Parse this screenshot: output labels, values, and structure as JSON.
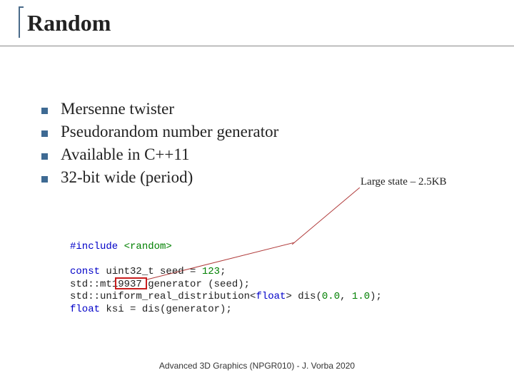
{
  "title": "Random",
  "bullets": [
    "Mersenne twister",
    "Pseudorandom number generator",
    "Available in C++11",
    "32-bit wide (period)"
  ],
  "annotation": "Large state – 2.5KB",
  "code": {
    "include_kw": "#include",
    "include_hdr": "<random>",
    "l1_a": "const",
    "l1_b": " uint32_t seed = ",
    "l1_c": "123",
    "l1_d": ";",
    "l2_a": "std::mt",
    "l2_hl": "19937",
    "l2_b": " generator (seed);",
    "l3_a": "std::uniform_real_distribution<",
    "l3_b": "float",
    "l3_c": "> dis(",
    "l3_d": "0.0",
    "l3_e": ", ",
    "l3_f": "1.0",
    "l3_g": ");",
    "l4_a": "float",
    "l4_b": " ksi = dis(generator);"
  },
  "footer": "Advanced 3D Graphics (NPGR010) - J. Vorba 2020"
}
